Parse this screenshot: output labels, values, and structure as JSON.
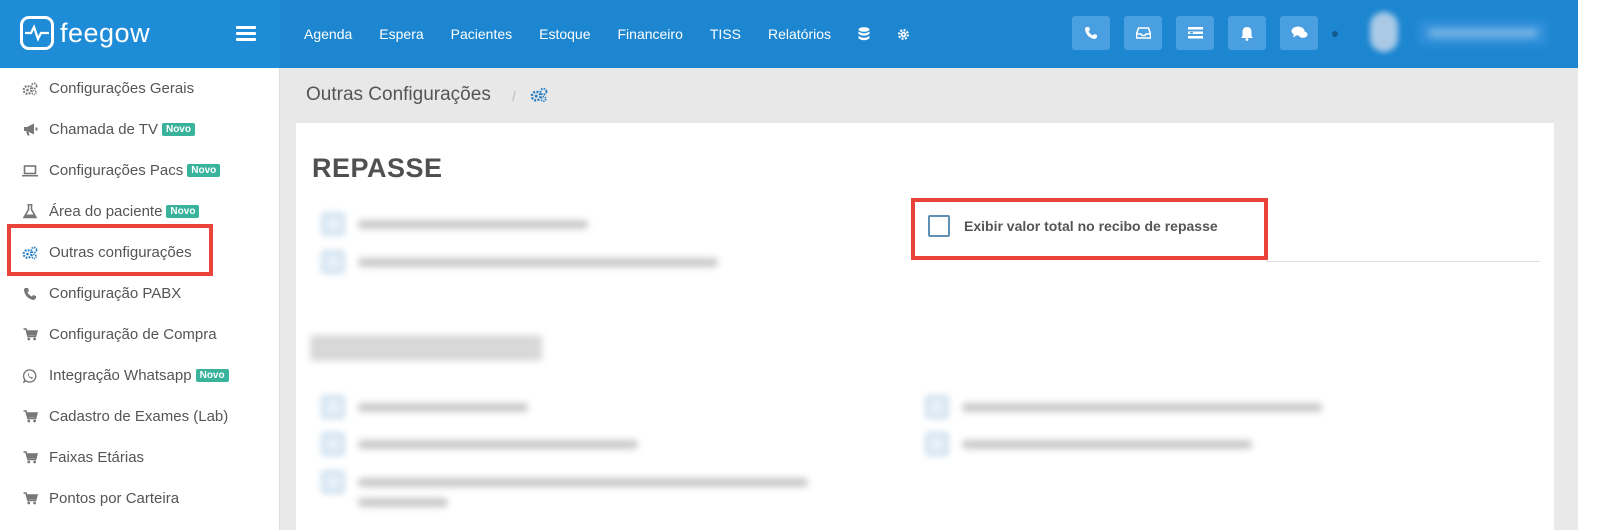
{
  "brand": {
    "name": "feegow"
  },
  "nav": [
    "Agenda",
    "Espera",
    "Pacientes",
    "Estoque",
    "Financeiro",
    "TISS",
    "Relatórios"
  ],
  "sidebar": {
    "items": [
      {
        "label": "Configurações Gerais",
        "icon": "gears-icon",
        "badge": ""
      },
      {
        "label": "Chamada de TV",
        "icon": "megaphone-icon",
        "badge": "Novo"
      },
      {
        "label": "Configurações Pacs",
        "icon": "laptop-icon",
        "badge": "Novo"
      },
      {
        "label": "Área do paciente",
        "icon": "flask-icon",
        "badge": "Novo"
      },
      {
        "label": "Outras configurações",
        "icon": "gears-icon",
        "badge": ""
      },
      {
        "label": "Configuração PABX",
        "icon": "phone-icon",
        "badge": ""
      },
      {
        "label": "Configuração de Compra",
        "icon": "cart-icon",
        "badge": ""
      },
      {
        "label": "Integração Whatsapp",
        "icon": "whatsapp-icon",
        "badge": "Novo"
      },
      {
        "label": "Cadastro de Exames (Lab)",
        "icon": "cart-icon",
        "badge": ""
      },
      {
        "label": "Faixas Etárias",
        "icon": "cart-icon",
        "badge": ""
      },
      {
        "label": "Pontos por Carteira",
        "icon": "cart-icon",
        "badge": ""
      }
    ]
  },
  "breadcrumb": {
    "title": "Outras Configurações"
  },
  "main": {
    "section_repasse": "REPASSE",
    "highlight_option": "Exibir valor total no recibo de repasse"
  },
  "colors": {
    "topbar": "#1d86d0",
    "accent_badge": "#39b39b",
    "highlight": "#e8443a"
  }
}
